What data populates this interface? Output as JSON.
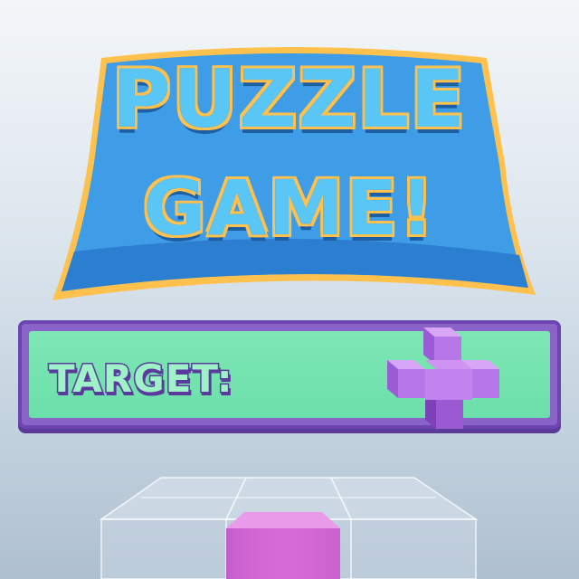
{
  "title": {
    "line1": "PUZZLE",
    "line2": "GAME!"
  },
  "target": {
    "label": "TARGET:",
    "shape_icon": "cross-cube-shape-icon"
  },
  "play_area": {
    "grid_icon": "transparent-cube-grid-icon",
    "block_icon": "pink-cube-block-icon"
  },
  "colors": {
    "title_fill": "#5ac6f6",
    "title_outline": "#1b63ad",
    "title_glow": "#ffc14d",
    "bar_frame": "#8a63c9",
    "bar_fill": "#7ee7b4",
    "shape_purple": "#b877e8",
    "block_pink": "#d66ad6"
  }
}
